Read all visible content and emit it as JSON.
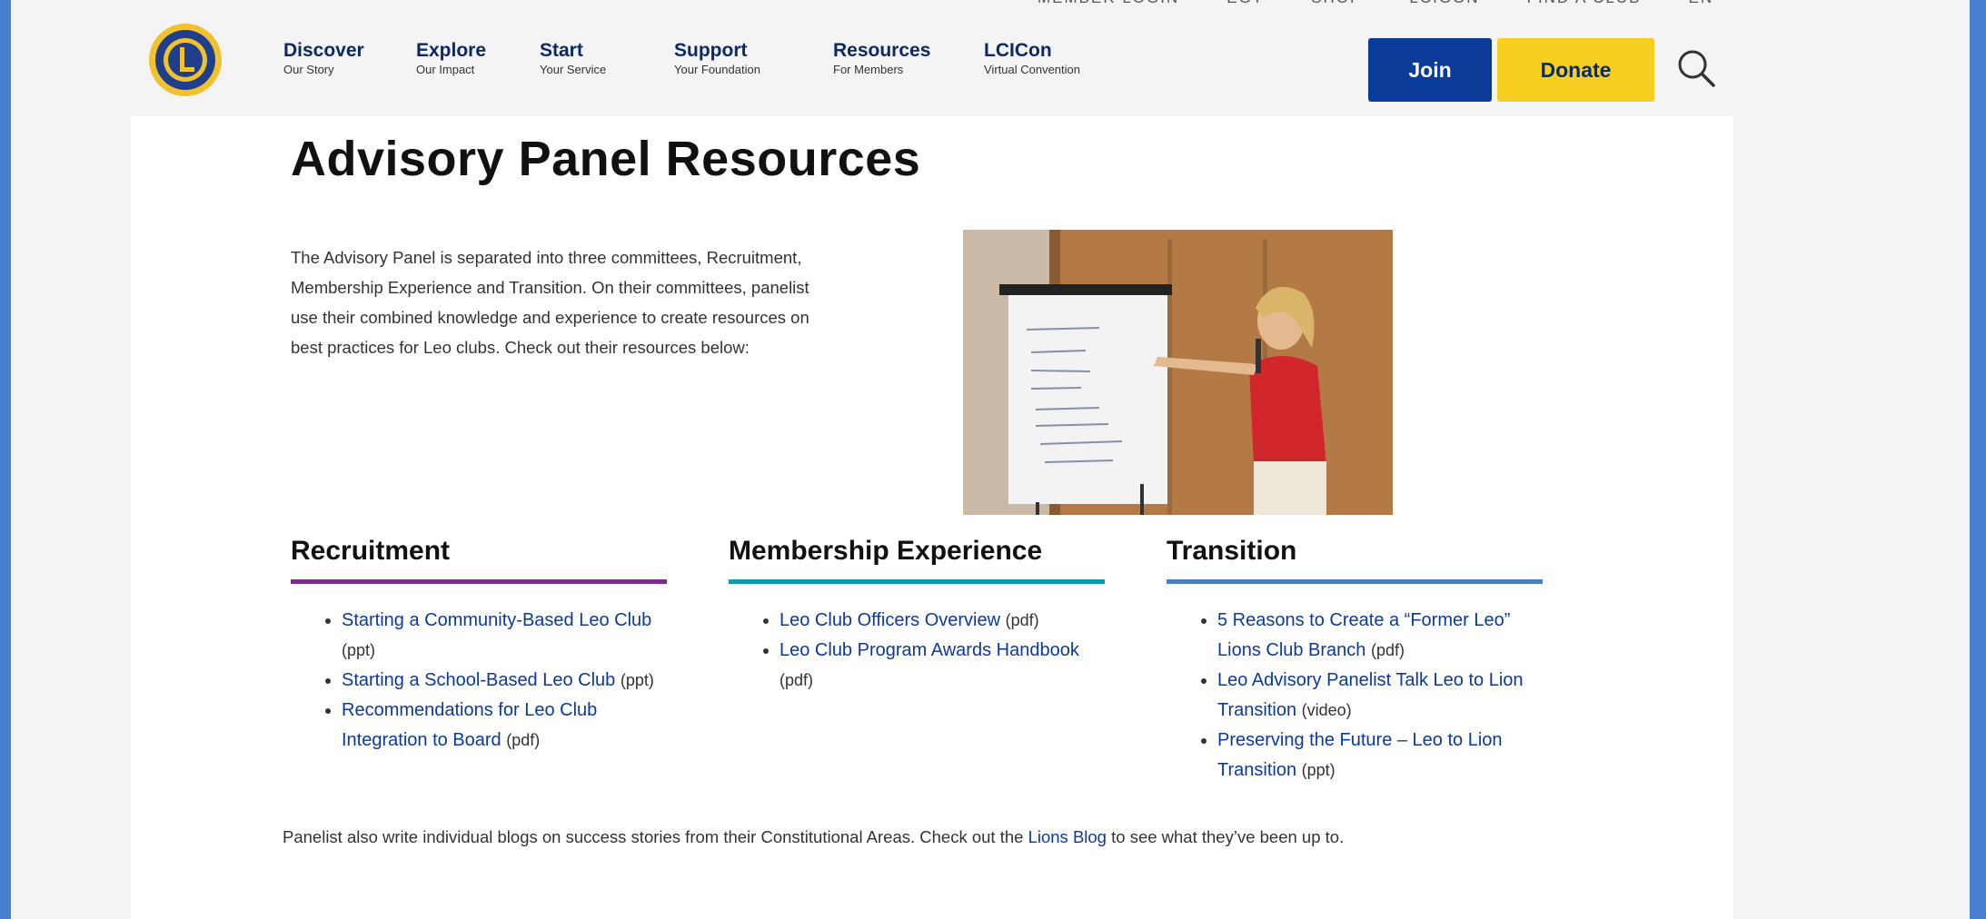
{
  "utility_bar": [
    "MEMBER LOGIN",
    "EGT",
    "SHOP",
    "LCIGON",
    "FIND A CLUB",
    "EN"
  ],
  "nav": [
    {
      "title": "Discover",
      "sub": "Our Story"
    },
    {
      "title": "Explore",
      "sub": "Our Impact"
    },
    {
      "title": "Start",
      "sub": "Your Service"
    },
    {
      "title": "Support",
      "sub": "Your Foundation"
    },
    {
      "title": "Resources",
      "sub": "For Members"
    },
    {
      "title": "LCICon",
      "sub": "Virtual Convention"
    }
  ],
  "buttons": {
    "join": "Join",
    "donate": "Donate"
  },
  "colors": {
    "join": "#0a3b99",
    "donate": "#f6cf21",
    "link": "#0c3a9a",
    "recruitment": "#7b2d8e",
    "membership": "#119aa8",
    "transition": "#4a7fc0"
  },
  "page": {
    "title": "Advisory Panel Resources",
    "intro": "The Advisory Panel is separated into three committees, Recruitment, Membership Experience and Transition. On their committees, panelist use their combined knowledge and experience to create resources on best practices for Leo clubs. Check out their resources below:"
  },
  "columns": [
    {
      "heading": "Recruitment",
      "items": [
        {
          "link": "Starting a Community-Based Leo Club",
          "kind": "(ppt)"
        },
        {
          "link": "Starting a School-Based Leo Club",
          "kind": "(ppt)"
        },
        {
          "link": "Recommendations for Leo Club Integration to Board",
          "kind": "(pdf)"
        }
      ]
    },
    {
      "heading": "Membership Experience",
      "items": [
        {
          "link": "Leo Club Officers Overview",
          "kind": "(pdf)"
        },
        {
          "link": "Leo Club Program Awards Handbook",
          "kind": "(pdf)"
        }
      ]
    },
    {
      "heading": "Transition",
      "items": [
        {
          "link": "5 Reasons to Create a “Former Leo” Lions Club Branch",
          "kind": "(pdf)"
        },
        {
          "link": "Leo Advisory Panelist Talk Leo to Lion Transition",
          "kind": "(video)"
        },
        {
          "link": "Preserving the Future – Leo to Lion Transition",
          "kind": "(ppt)"
        }
      ]
    }
  ],
  "footer": {
    "before": "Panelist also write individual blogs on success stories from their Constitutional Areas. Check out the ",
    "link": "Lions Blog",
    "after": " to see what they’ve been up to."
  },
  "icons": {
    "search": "search-icon",
    "logo": "lions-logo-icon"
  }
}
